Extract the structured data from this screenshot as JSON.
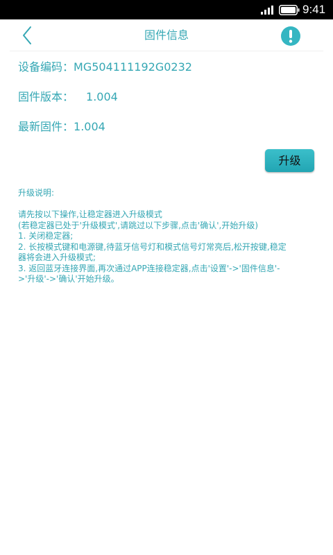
{
  "status_bar": {
    "time": "9:41",
    "signal_icon": "cell-signal-icon",
    "battery_icon": "battery-icon"
  },
  "header": {
    "title": "固件信息",
    "back_icon": "chevron-left-icon",
    "info_icon": "exclamation-circle-icon",
    "accent_color": "#35a7b4"
  },
  "device": {
    "device_code_label": "设备编码：",
    "device_code_value": "MG504111192G0232",
    "firmware_version_label": "固件版本：",
    "firmware_version_value": "1.004",
    "latest_firmware_label": "最新固件：",
    "latest_firmware_value": "1.004"
  },
  "upgrade_button": {
    "label": "升级",
    "color": "#2fb6c2"
  },
  "instructions": {
    "title": "升级说明:",
    "lines": [
      "请先按以下操作,让稳定器进入升级模式",
      "(若稳定器已处于'升级模式',请跳过以下步骤,点击'确认',开始升级)",
      "1. 关闭稳定器;",
      "2. 长按模式键和电源键,待蓝牙信号灯和模式信号灯常亮后,松开按键,稳定",
      "器将会进入升级模式;",
      "3. 返回蓝牙连接界面,再次通过APP连接稳定器,点击'设置'->'固件信息'-",
      ">'升级'->'确认'开始升级。"
    ]
  }
}
